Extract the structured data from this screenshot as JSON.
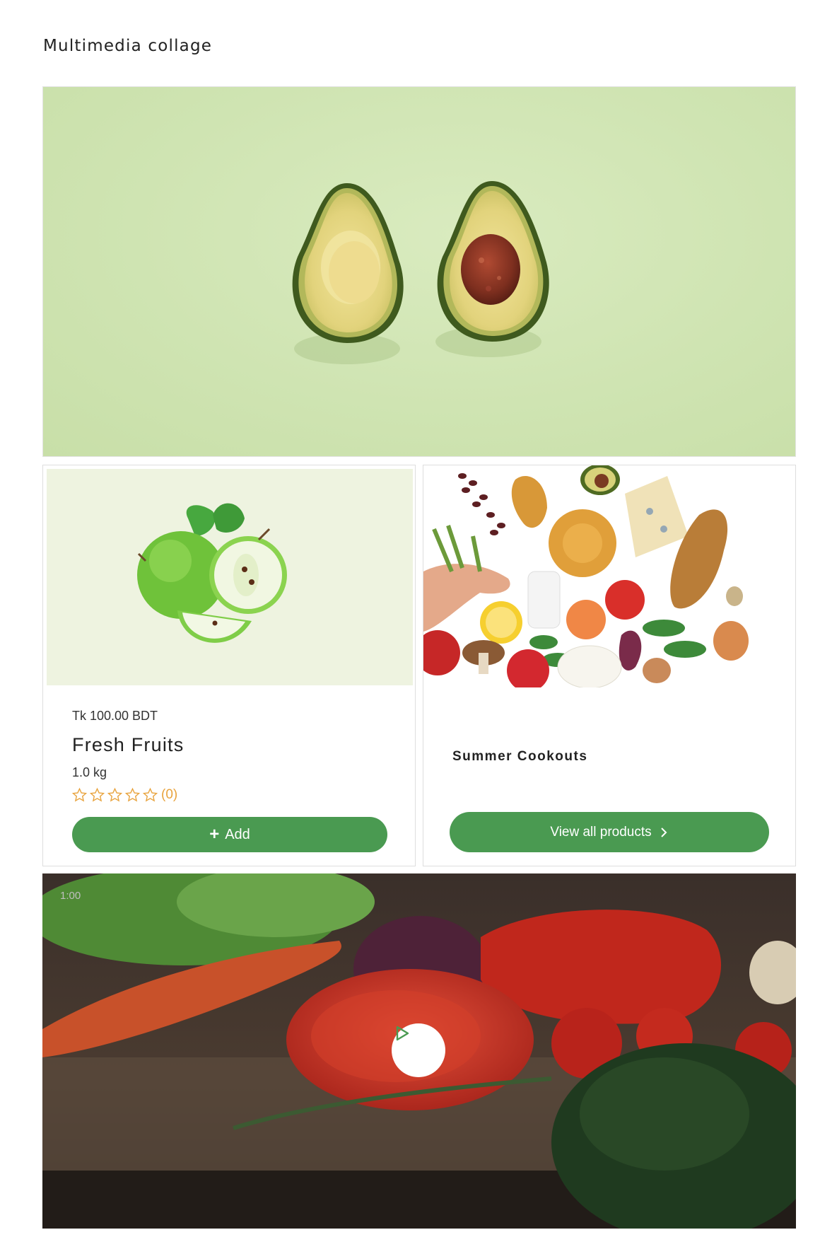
{
  "section": {
    "title": "Multimedia collage"
  },
  "hero": {
    "icon": "avocado-image"
  },
  "product": {
    "price": "Tk 100.00 BDT",
    "name": "Fresh Fruits",
    "weight": "1.0 kg",
    "rating_stars": 0,
    "rating_max": 5,
    "rating_count": "(0)",
    "add_label": "Add",
    "accent": "#4a9a51",
    "star_color": "#e8a33d"
  },
  "collection": {
    "name": "Summer Cookouts",
    "button_label": "View all products"
  },
  "video": {
    "timestamp": "1:00"
  }
}
